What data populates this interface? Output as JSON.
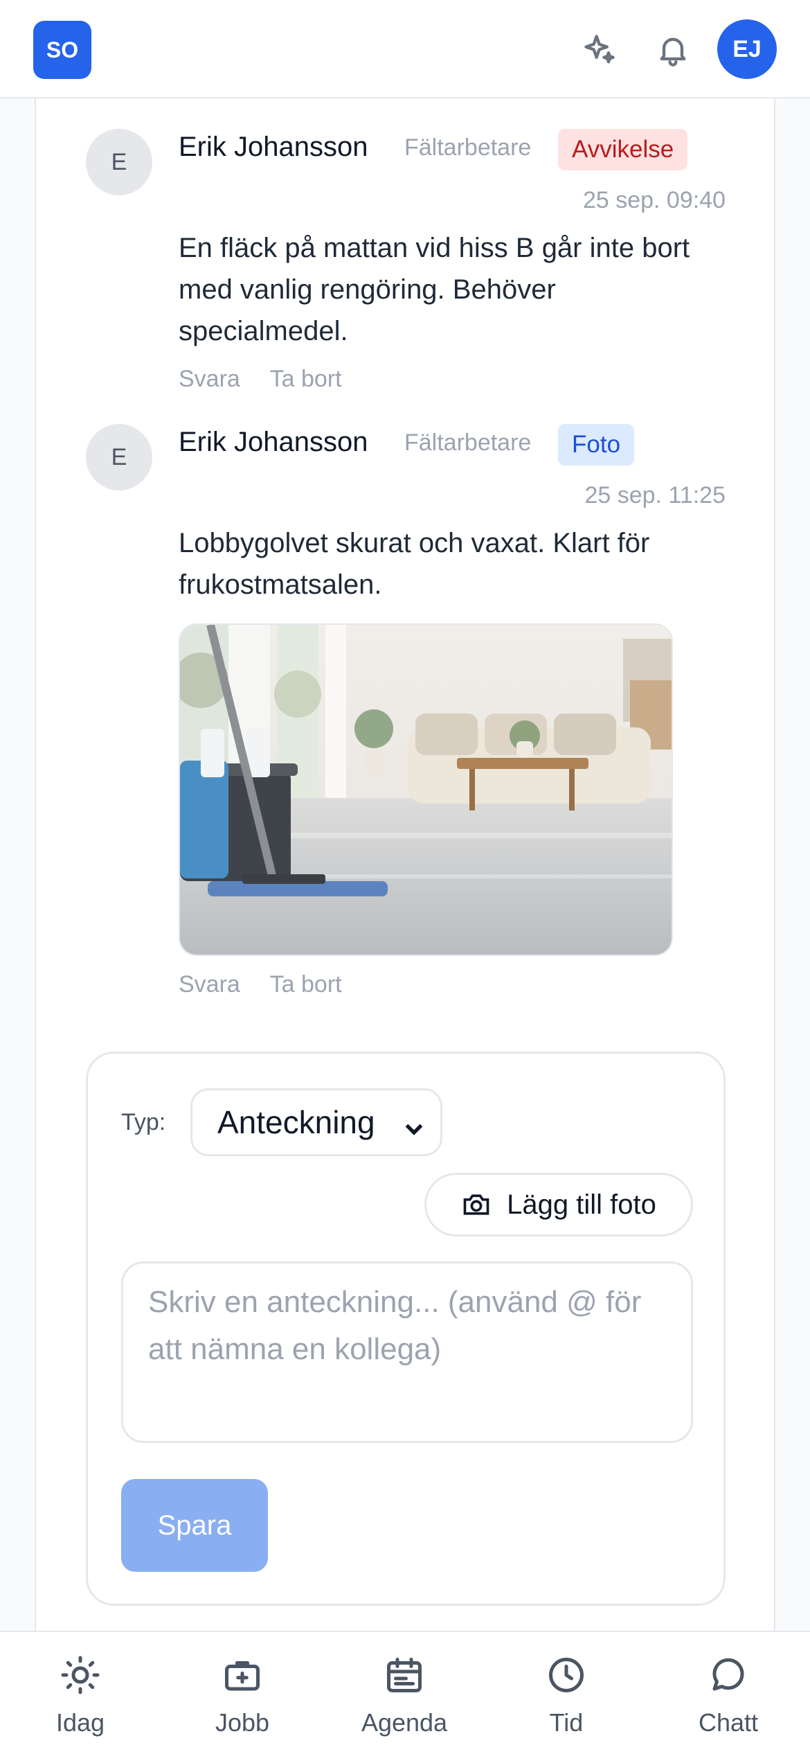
{
  "header": {
    "logo_text": "SO",
    "ai_icon": "sparkles-icon",
    "notifications_icon": "bell-icon",
    "user_initials": "EJ",
    "accent": "#2563eb"
  },
  "notes": [
    {
      "avatar_initial": "E",
      "author": "Erik Johansson",
      "role": "Fältarbetare",
      "badge": "Avvikelse",
      "badge_color": "#b91c1c",
      "time": "25 sep. 09:40",
      "text": "En fläck på mattan vid hiss B går inte bort med vanlig rengöring. Behöver specialmedel.",
      "reply_label": "Svara",
      "delete_label": "Ta bort"
    },
    {
      "avatar_initial": "E",
      "author": "Erik Johansson",
      "role": "Fältarbetare",
      "badge": "Foto",
      "badge_color": "#1d4ed8",
      "time": "25 sep. 11:25",
      "text": "Lobbygolvet skurat och vaxat. Klart för frukostmatsalen.",
      "photo": "photo-lobby-floor-mop",
      "reply_label": "Svara",
      "delete_label": "Ta bort"
    }
  ],
  "composer": {
    "type_label": "Typ:",
    "type_value": "Anteckning",
    "add_photo_label": "Lägg till foto",
    "placeholder": "Skriv en anteckning... (använd @ för att nämna en kollega)",
    "save_label": "Spara"
  },
  "bottom_nav": [
    {
      "label": "Idag",
      "icon": "sun-icon"
    },
    {
      "label": "Jobb",
      "icon": "briefcase-icon"
    },
    {
      "label": "Agenda",
      "icon": "calendar-icon"
    },
    {
      "label": "Tid",
      "icon": "clock-icon"
    },
    {
      "label": "Chatt",
      "icon": "chat-icon"
    }
  ]
}
